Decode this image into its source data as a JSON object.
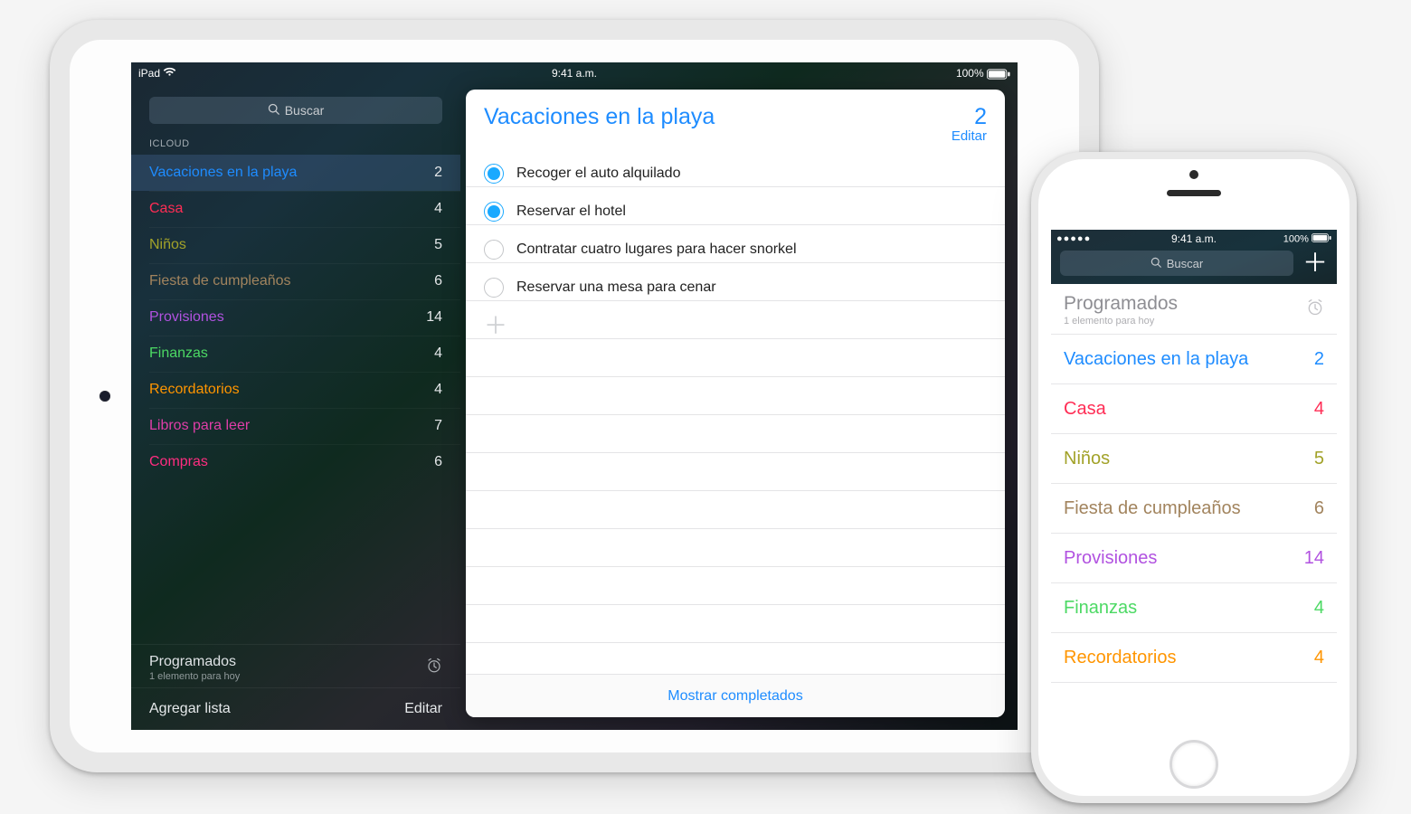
{
  "ipad": {
    "status": {
      "device": "iPad",
      "time": "9:41 a.m.",
      "battery": "100%"
    },
    "sidebar": {
      "search_placeholder": "Buscar",
      "section_header": "ICLOUD",
      "lists": [
        {
          "label": "Vacaciones en la playa",
          "count": "2",
          "color": "c-blue",
          "selected": true
        },
        {
          "label": "Casa",
          "count": "4",
          "color": "c-red",
          "selected": false
        },
        {
          "label": "Niños",
          "count": "5",
          "color": "c-olive",
          "selected": false
        },
        {
          "label": "Fiesta de cumpleaños",
          "count": "6",
          "color": "c-brown",
          "selected": false
        },
        {
          "label": "Provisiones",
          "count": "14",
          "color": "c-purple",
          "selected": false
        },
        {
          "label": "Finanzas",
          "count": "4",
          "color": "c-green",
          "selected": false
        },
        {
          "label": "Recordatorios",
          "count": "4",
          "color": "c-orange",
          "selected": false
        },
        {
          "label": "Libros para leer",
          "count": "7",
          "color": "c-magenta",
          "selected": false
        },
        {
          "label": "Compras",
          "count": "6",
          "color": "c-pink",
          "selected": false
        }
      ],
      "scheduled": {
        "title": "Programados",
        "subtitle": "1 elemento para hoy"
      },
      "footer": {
        "add_list": "Agregar lista",
        "edit": "Editar"
      }
    },
    "detail": {
      "title": "Vacaciones en la playa",
      "count": "2",
      "edit": "Editar",
      "reminders": [
        {
          "text": "Recoger el auto alquilado",
          "done": true
        },
        {
          "text": "Reservar el hotel",
          "done": true
        },
        {
          "text": "Contratar cuatro lugares para hacer snorkel",
          "done": false
        },
        {
          "text": "Reservar una mesa para cenar",
          "done": false
        }
      ],
      "show_completed": "Mostrar completados"
    }
  },
  "iphone": {
    "status": {
      "time": "9:41 a.m.",
      "battery": "100%"
    },
    "search_placeholder": "Buscar",
    "scheduled": {
      "title": "Programados",
      "subtitle": "1 elemento para hoy"
    },
    "lists": [
      {
        "label": "Vacaciones en la playa",
        "count": "2",
        "color": "c-blue"
      },
      {
        "label": "Casa",
        "count": "4",
        "color": "c-red"
      },
      {
        "label": "Niños",
        "count": "5",
        "color": "c-olive"
      },
      {
        "label": "Fiesta de cumpleaños",
        "count": "6",
        "color": "c-brown"
      },
      {
        "label": "Provisiones",
        "count": "14",
        "color": "c-purple"
      },
      {
        "label": "Finanzas",
        "count": "4",
        "color": "c-green"
      },
      {
        "label": "Recordatorios",
        "count": "4",
        "color": "c-orange"
      }
    ]
  }
}
